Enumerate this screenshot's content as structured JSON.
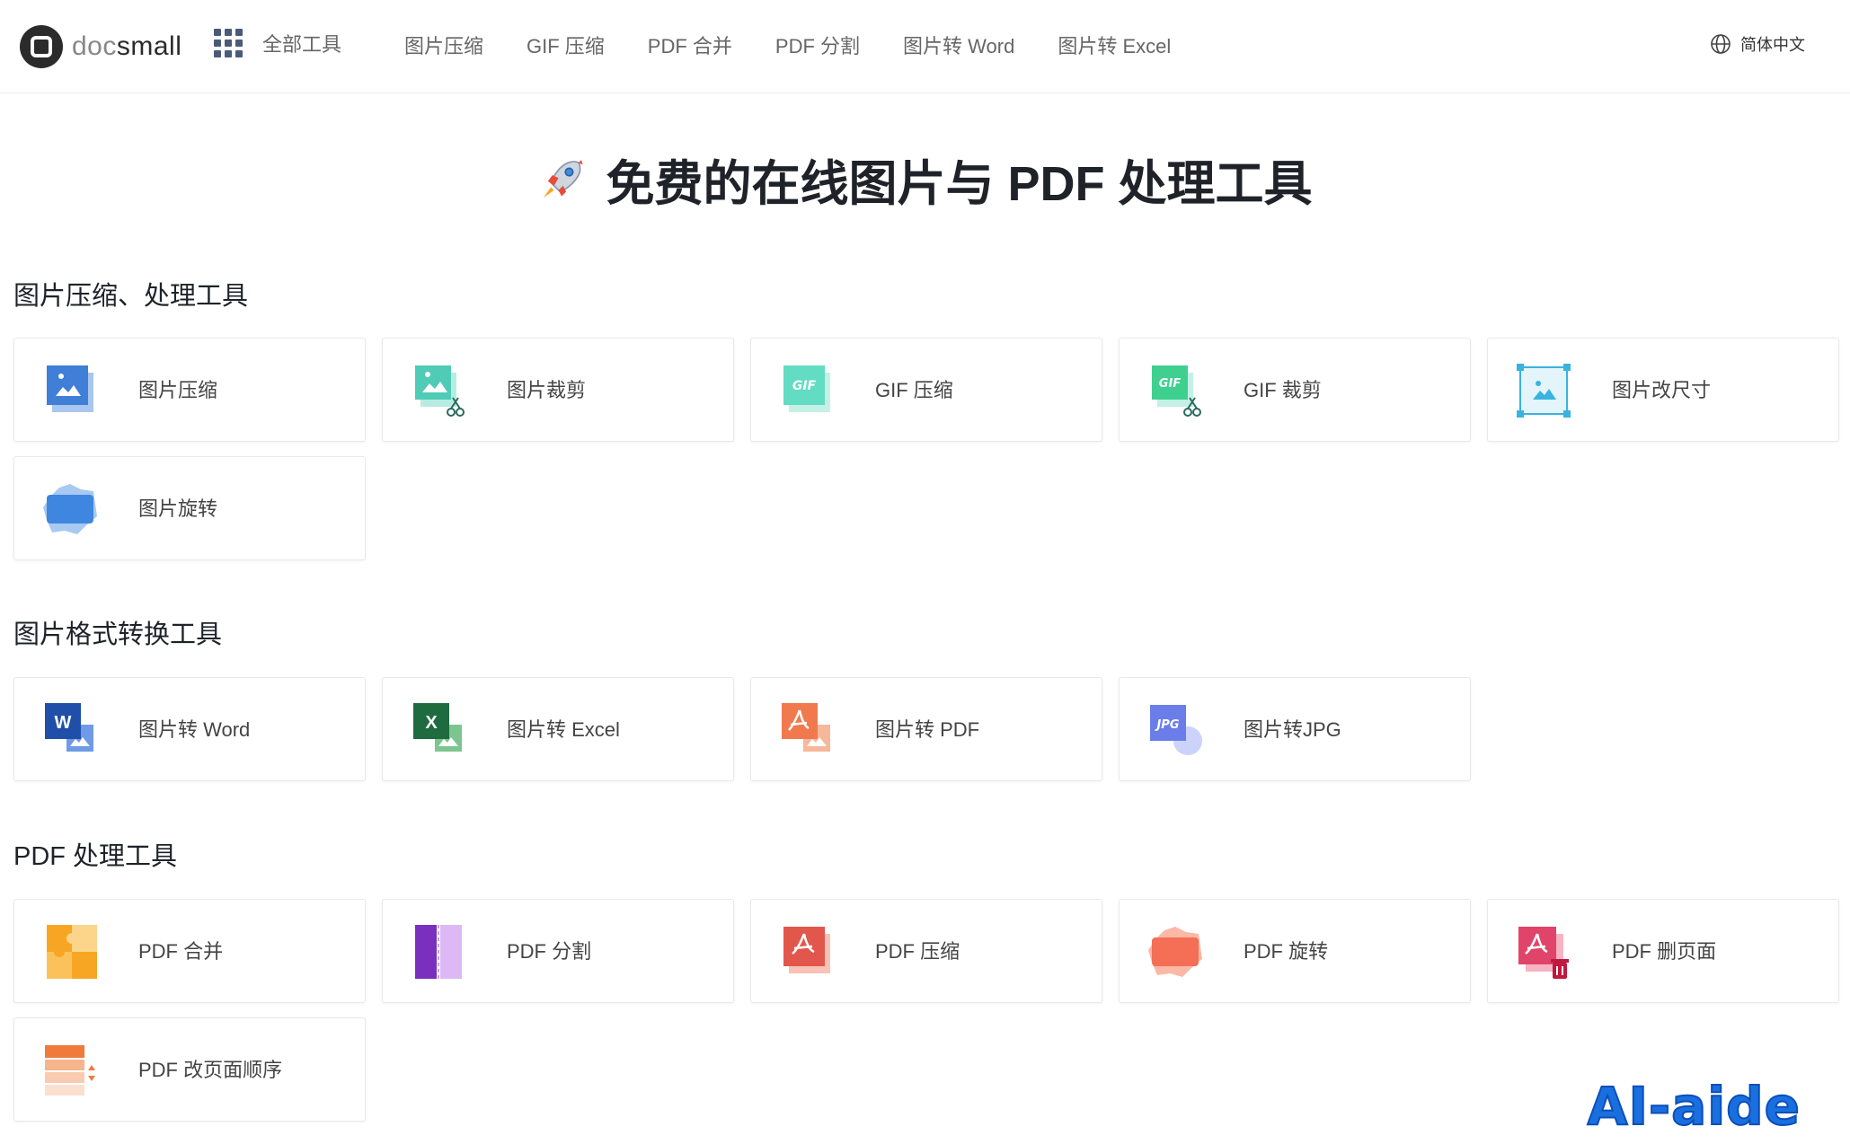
{
  "header": {
    "logo_prefix": "doc",
    "logo_suffix": "small",
    "all_tools_label": "全部工具",
    "nav": [
      "图片压缩",
      "GIF 压缩",
      "PDF 合并",
      "PDF 分割",
      "图片转 Word",
      "图片转 Excel"
    ],
    "language": "简体中文"
  },
  "hero": {
    "title": "免费的在线图片与 PDF 处理工具"
  },
  "sections": [
    {
      "title": "图片压缩、处理工具",
      "tools": [
        {
          "label": "图片压缩",
          "icon": "image-compress-icon"
        },
        {
          "label": "图片裁剪",
          "icon": "image-crop-icon"
        },
        {
          "label": "GIF 压缩",
          "icon": "gif-compress-icon"
        },
        {
          "label": "GIF 裁剪",
          "icon": "gif-crop-icon"
        },
        {
          "label": "图片改尺寸",
          "icon": "image-resize-icon"
        },
        {
          "label": "图片旋转",
          "icon": "image-rotate-icon"
        }
      ]
    },
    {
      "title": "图片格式转换工具",
      "tools": [
        {
          "label": "图片转 Word",
          "icon": "image-to-word-icon"
        },
        {
          "label": "图片转 Excel",
          "icon": "image-to-excel-icon"
        },
        {
          "label": "图片转 PDF",
          "icon": "image-to-pdf-icon"
        },
        {
          "label": "图片转JPG",
          "icon": "image-to-jpg-icon"
        }
      ]
    },
    {
      "title": "PDF 处理工具",
      "tools": [
        {
          "label": "PDF 合并",
          "icon": "pdf-merge-icon"
        },
        {
          "label": "PDF 分割",
          "icon": "pdf-split-icon"
        },
        {
          "label": "PDF 压缩",
          "icon": "pdf-compress-icon"
        },
        {
          "label": "PDF 旋转",
          "icon": "pdf-rotate-icon"
        },
        {
          "label": "PDF 删页面",
          "icon": "pdf-delete-page-icon"
        },
        {
          "label": "PDF 改页面顺序",
          "icon": "pdf-reorder-icon"
        }
      ]
    }
  ],
  "watermark": "AI-aide",
  "colors": {
    "image_blue": "#3f7fd8",
    "gif_teal": "#4fd1b8",
    "word_blue": "#1f4fa8",
    "excel_green": "#1e6b3f",
    "pdf_orange": "#f07a4e",
    "pdf_red": "#e2574c",
    "jpg_purple": "#6b7de8",
    "merge_orange": "#f7a623",
    "split_purple": "#7b2fbf"
  }
}
